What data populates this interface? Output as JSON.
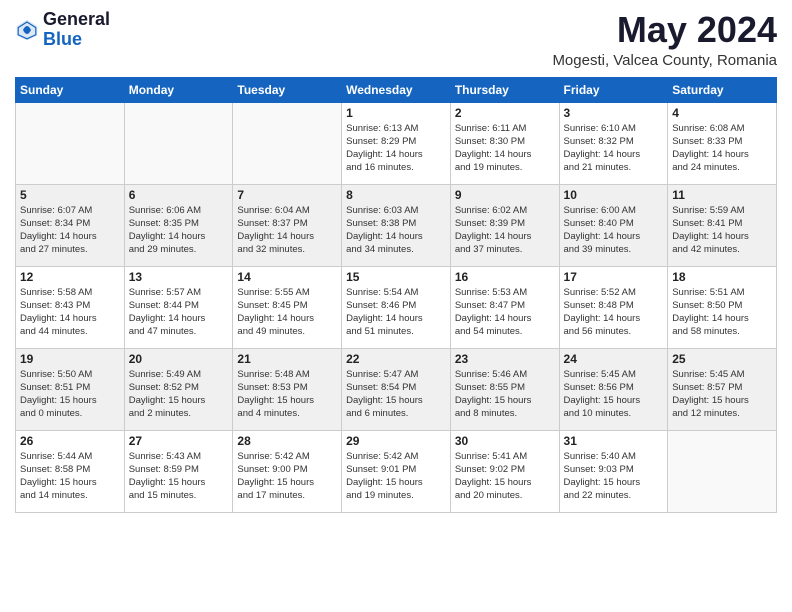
{
  "header": {
    "logo_general": "General",
    "logo_blue": "Blue",
    "month_title": "May 2024",
    "location": "Mogesti, Valcea County, Romania"
  },
  "weekdays": [
    "Sunday",
    "Monday",
    "Tuesday",
    "Wednesday",
    "Thursday",
    "Friday",
    "Saturday"
  ],
  "weeks": [
    [
      {
        "day": "",
        "info": ""
      },
      {
        "day": "",
        "info": ""
      },
      {
        "day": "",
        "info": ""
      },
      {
        "day": "1",
        "info": "Sunrise: 6:13 AM\nSunset: 8:29 PM\nDaylight: 14 hours\nand 16 minutes."
      },
      {
        "day": "2",
        "info": "Sunrise: 6:11 AM\nSunset: 8:30 PM\nDaylight: 14 hours\nand 19 minutes."
      },
      {
        "day": "3",
        "info": "Sunrise: 6:10 AM\nSunset: 8:32 PM\nDaylight: 14 hours\nand 21 minutes."
      },
      {
        "day": "4",
        "info": "Sunrise: 6:08 AM\nSunset: 8:33 PM\nDaylight: 14 hours\nand 24 minutes."
      }
    ],
    [
      {
        "day": "5",
        "info": "Sunrise: 6:07 AM\nSunset: 8:34 PM\nDaylight: 14 hours\nand 27 minutes."
      },
      {
        "day": "6",
        "info": "Sunrise: 6:06 AM\nSunset: 8:35 PM\nDaylight: 14 hours\nand 29 minutes."
      },
      {
        "day": "7",
        "info": "Sunrise: 6:04 AM\nSunset: 8:37 PM\nDaylight: 14 hours\nand 32 minutes."
      },
      {
        "day": "8",
        "info": "Sunrise: 6:03 AM\nSunset: 8:38 PM\nDaylight: 14 hours\nand 34 minutes."
      },
      {
        "day": "9",
        "info": "Sunrise: 6:02 AM\nSunset: 8:39 PM\nDaylight: 14 hours\nand 37 minutes."
      },
      {
        "day": "10",
        "info": "Sunrise: 6:00 AM\nSunset: 8:40 PM\nDaylight: 14 hours\nand 39 minutes."
      },
      {
        "day": "11",
        "info": "Sunrise: 5:59 AM\nSunset: 8:41 PM\nDaylight: 14 hours\nand 42 minutes."
      }
    ],
    [
      {
        "day": "12",
        "info": "Sunrise: 5:58 AM\nSunset: 8:43 PM\nDaylight: 14 hours\nand 44 minutes."
      },
      {
        "day": "13",
        "info": "Sunrise: 5:57 AM\nSunset: 8:44 PM\nDaylight: 14 hours\nand 47 minutes."
      },
      {
        "day": "14",
        "info": "Sunrise: 5:55 AM\nSunset: 8:45 PM\nDaylight: 14 hours\nand 49 minutes."
      },
      {
        "day": "15",
        "info": "Sunrise: 5:54 AM\nSunset: 8:46 PM\nDaylight: 14 hours\nand 51 minutes."
      },
      {
        "day": "16",
        "info": "Sunrise: 5:53 AM\nSunset: 8:47 PM\nDaylight: 14 hours\nand 54 minutes."
      },
      {
        "day": "17",
        "info": "Sunrise: 5:52 AM\nSunset: 8:48 PM\nDaylight: 14 hours\nand 56 minutes."
      },
      {
        "day": "18",
        "info": "Sunrise: 5:51 AM\nSunset: 8:50 PM\nDaylight: 14 hours\nand 58 minutes."
      }
    ],
    [
      {
        "day": "19",
        "info": "Sunrise: 5:50 AM\nSunset: 8:51 PM\nDaylight: 15 hours\nand 0 minutes."
      },
      {
        "day": "20",
        "info": "Sunrise: 5:49 AM\nSunset: 8:52 PM\nDaylight: 15 hours\nand 2 minutes."
      },
      {
        "day": "21",
        "info": "Sunrise: 5:48 AM\nSunset: 8:53 PM\nDaylight: 15 hours\nand 4 minutes."
      },
      {
        "day": "22",
        "info": "Sunrise: 5:47 AM\nSunset: 8:54 PM\nDaylight: 15 hours\nand 6 minutes."
      },
      {
        "day": "23",
        "info": "Sunrise: 5:46 AM\nSunset: 8:55 PM\nDaylight: 15 hours\nand 8 minutes."
      },
      {
        "day": "24",
        "info": "Sunrise: 5:45 AM\nSunset: 8:56 PM\nDaylight: 15 hours\nand 10 minutes."
      },
      {
        "day": "25",
        "info": "Sunrise: 5:45 AM\nSunset: 8:57 PM\nDaylight: 15 hours\nand 12 minutes."
      }
    ],
    [
      {
        "day": "26",
        "info": "Sunrise: 5:44 AM\nSunset: 8:58 PM\nDaylight: 15 hours\nand 14 minutes."
      },
      {
        "day": "27",
        "info": "Sunrise: 5:43 AM\nSunset: 8:59 PM\nDaylight: 15 hours\nand 15 minutes."
      },
      {
        "day": "28",
        "info": "Sunrise: 5:42 AM\nSunset: 9:00 PM\nDaylight: 15 hours\nand 17 minutes."
      },
      {
        "day": "29",
        "info": "Sunrise: 5:42 AM\nSunset: 9:01 PM\nDaylight: 15 hours\nand 19 minutes."
      },
      {
        "day": "30",
        "info": "Sunrise: 5:41 AM\nSunset: 9:02 PM\nDaylight: 15 hours\nand 20 minutes."
      },
      {
        "day": "31",
        "info": "Sunrise: 5:40 AM\nSunset: 9:03 PM\nDaylight: 15 hours\nand 22 minutes."
      },
      {
        "day": "",
        "info": ""
      }
    ]
  ]
}
